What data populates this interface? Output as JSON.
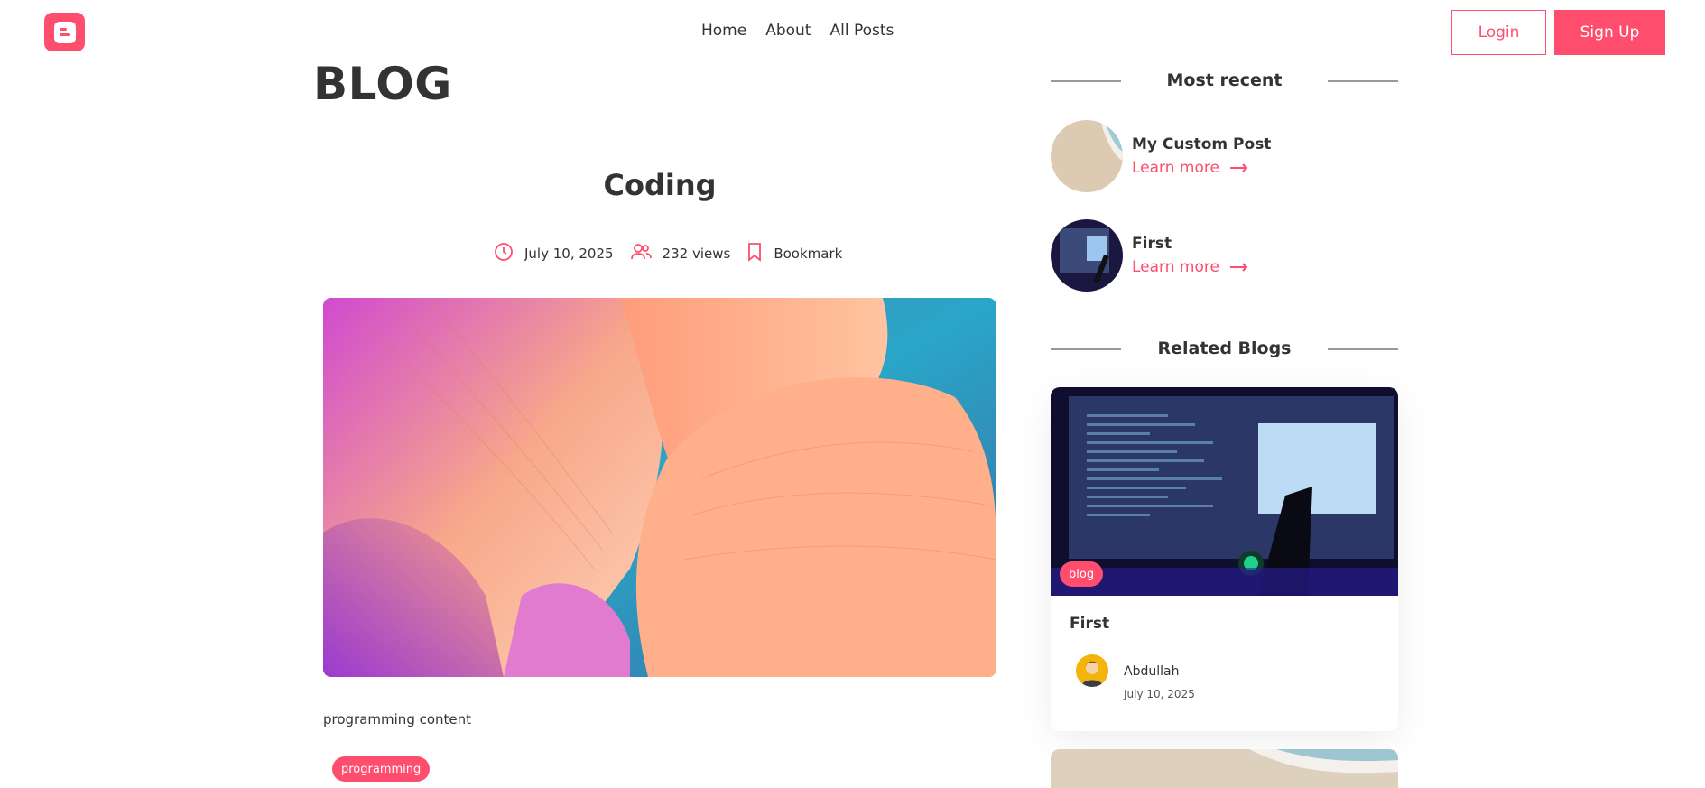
{
  "header": {
    "logo_icon": "blogger-logo-icon",
    "nav": [
      "Home",
      "About",
      "All Posts"
    ],
    "login_label": "Login",
    "signup_label": "Sign Up"
  },
  "main": {
    "heading": "BLOG",
    "post_title": "Coding",
    "meta": {
      "date": "July 10, 2025",
      "views": "232 views",
      "bookmark": "Bookmark"
    },
    "content": "programming content",
    "tag": "programming"
  },
  "sidebar": {
    "recent_title": "Most recent",
    "recent": [
      {
        "title": "My Custom Post",
        "link": "Learn more"
      },
      {
        "title": "First",
        "link": "Learn more"
      }
    ],
    "related_title": "Related Blogs",
    "related": [
      {
        "tag": "blog",
        "title": "First",
        "author": "Abdullah",
        "date": "July 10, 2025"
      }
    ]
  },
  "colors": {
    "accent": "#ff4d6d",
    "text": "#333333"
  }
}
